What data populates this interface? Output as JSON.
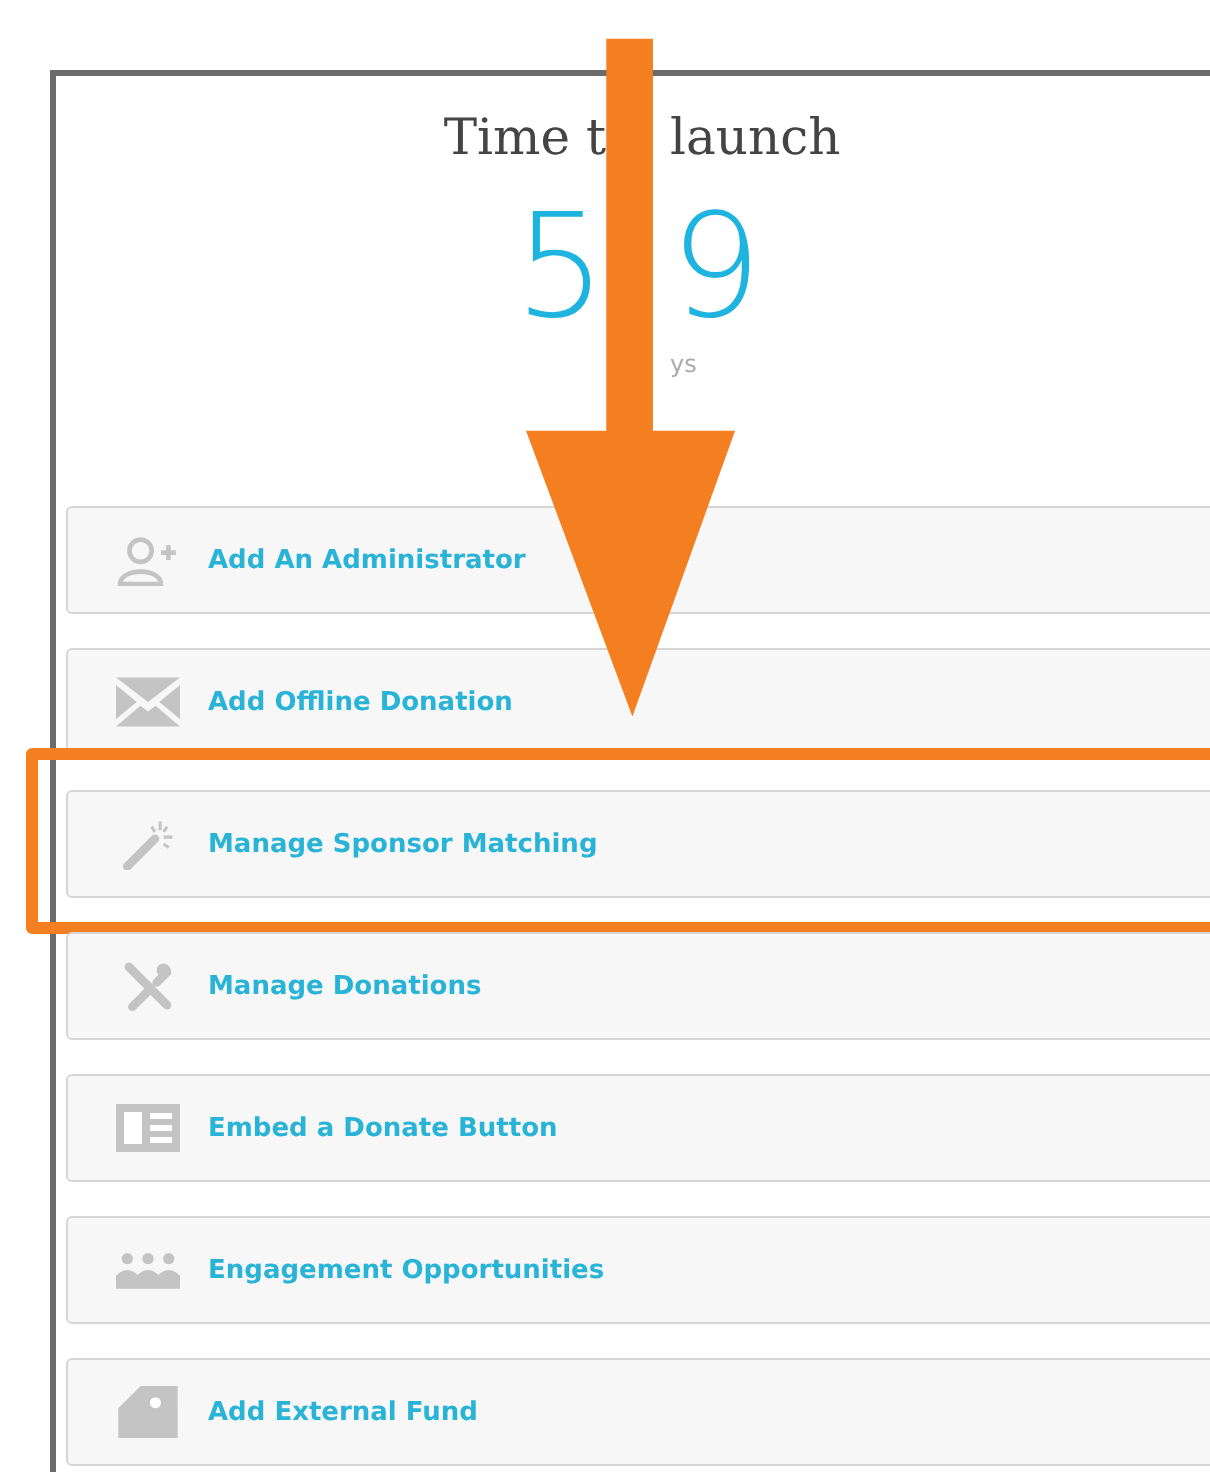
{
  "header": {
    "title": [
      "Time t",
      "launch"
    ],
    "count": [
      "5",
      "9"
    ],
    "unit": "ys"
  },
  "actions": [
    {
      "label": "Add An Administrator",
      "kind": "add-user",
      "highlighted": false
    },
    {
      "label": "Add Offline Donation",
      "kind": "envelope",
      "highlighted": false
    },
    {
      "label": "Manage Sponsor Matching",
      "kind": "wand",
      "highlighted": true
    },
    {
      "label": "Manage Donations",
      "kind": "tools",
      "highlighted": false
    },
    {
      "label": "Embed a Donate Button",
      "kind": "embed",
      "highlighted": false
    },
    {
      "label": "Engagement Opportunities",
      "kind": "people",
      "highlighted": false
    },
    {
      "label": "Add External Fund",
      "kind": "tag",
      "highlighted": false
    }
  ]
}
